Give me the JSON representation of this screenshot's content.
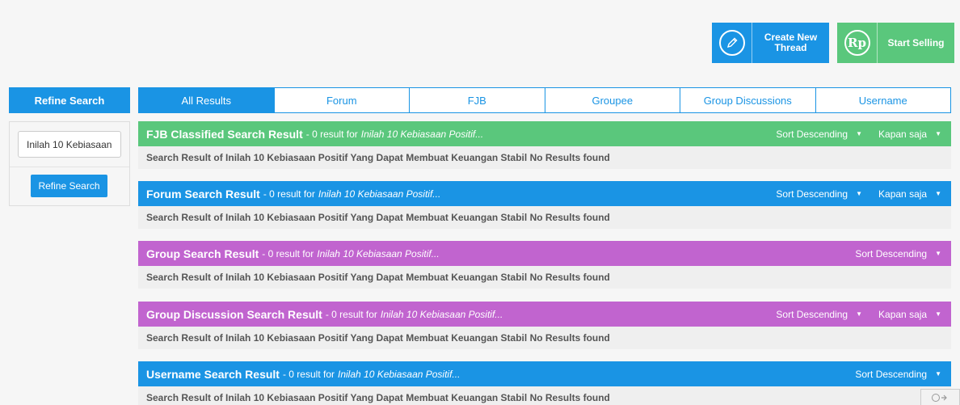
{
  "actions": {
    "create_thread": "Create New Thread",
    "start_selling": "Start Selling",
    "rp_symbol": "Rp"
  },
  "sidebar": {
    "title": "Refine Search",
    "search_value": "Inilah 10 Kebiasaan",
    "button": "Refine Search"
  },
  "tabs": [
    "All Results",
    "Forum",
    "FJB",
    "Groupee",
    "Group Discussions",
    "Username"
  ],
  "sections": [
    {
      "title": "FJB Classified Search Result",
      "meta": "- 0 result for",
      "query": "Inilah 10 Kebiasaan Positif...",
      "sort": "Sort Descending",
      "time": "Kapan saja",
      "body": "Search Result of Inilah 10 Kebiasaan Positif Yang Dapat Membuat Keuangan Stabil No Results found",
      "color": "#5ac77c"
    },
    {
      "title": "Forum Search Result",
      "meta": "- 0 result for",
      "query": "Inilah 10 Kebiasaan Positif...",
      "sort": "Sort Descending",
      "time": "Kapan saja",
      "body": "Search Result of Inilah 10 Kebiasaan Positif Yang Dapat Membuat Keuangan Stabil No Results found",
      "color": "#1a94e4"
    },
    {
      "title": "Group Search Result",
      "meta": "- 0 result for",
      "query": "Inilah 10 Kebiasaan Positif...",
      "sort": "Sort Descending",
      "body": "Search Result of Inilah 10 Kebiasaan Positif Yang Dapat Membuat Keuangan Stabil No Results found",
      "color": "#c164cf"
    },
    {
      "title": "Group Discussion Search Result",
      "meta": "- 0 result for",
      "query": "Inilah 10 Kebiasaan Positif...",
      "sort": "Sort Descending",
      "time": "Kapan saja",
      "body": "Search Result of Inilah 10 Kebiasaan Positif Yang Dapat Membuat Keuangan Stabil No Results found",
      "color": "#c164cf"
    },
    {
      "title": "Username Search Result",
      "meta": "- 0 result for",
      "query": "Inilah 10 Kebiasaan Positif...",
      "sort": "Sort Descending",
      "body": "Search Result of Inilah 10 Kebiasaan Positif Yang Dapat Membuat Keuangan Stabil No Results found",
      "color": "#1a94e4"
    }
  ],
  "icons": {
    "create_thread": "pencil-icon",
    "start_selling": "rupiah-icon",
    "dropdown": "caret-down-icon"
  }
}
